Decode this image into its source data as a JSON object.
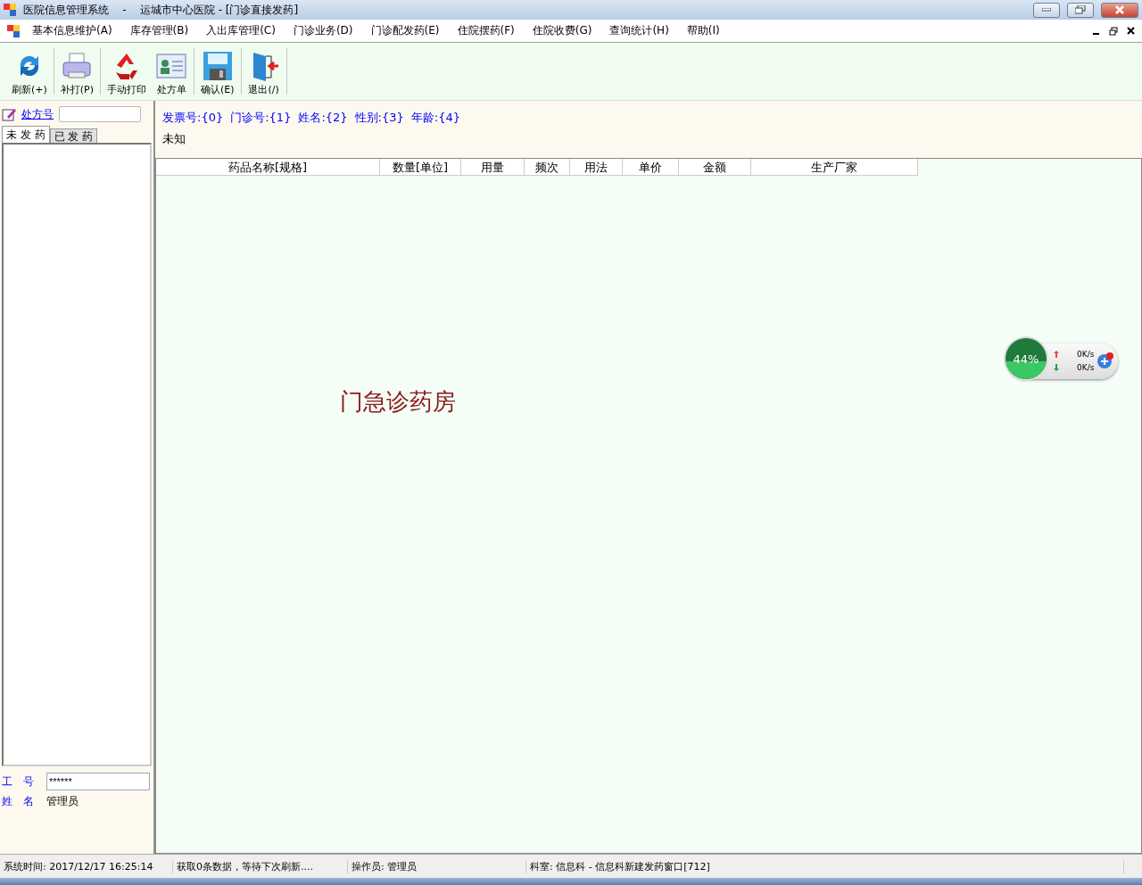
{
  "window": {
    "title": "医院信息管理系统    -    运城市中心医院 - [门诊直接发药]"
  },
  "menu": [
    "基本信息维护(A)",
    "库存管理(B)",
    "入出库管理(C)",
    "门诊业务(D)",
    "门诊配发药(E)",
    "住院摆药(F)",
    "住院收费(G)",
    "查询统计(H)",
    "帮助(I)"
  ],
  "toolbar": [
    {
      "kind": "refresh",
      "label": "刷新(+)",
      "sep": true
    },
    {
      "kind": "print",
      "label": "补打(P)",
      "sep": true
    },
    {
      "kind": "recycle",
      "label": "手动打印",
      "sep": false
    },
    {
      "kind": "card",
      "label": "处方单",
      "sep": true
    },
    {
      "kind": "save",
      "label": "确认(E)",
      "sep": true
    },
    {
      "kind": "exit",
      "label": "退出(/)",
      "sep": true
    }
  ],
  "left": {
    "prescription_link": "处方号",
    "tabs": [
      {
        "label": "未 发 药",
        "selected": true
      },
      {
        "label": "已 发 药",
        "selected": false
      }
    ],
    "staff_id_label": "工　号",
    "staff_id_value": "******",
    "name_label": "姓　名",
    "name_value": "管理员"
  },
  "info": {
    "fields": [
      "发票号:{0}",
      "门诊号:{1}",
      "姓名:{2}",
      "性别:{3}",
      "年龄:{4}"
    ],
    "line2": "未知"
  },
  "table": {
    "columns": [
      "药品名称[规格]",
      "数量[单位]",
      "用量",
      "频次",
      "用法",
      "单价",
      "金额",
      "生产厂家"
    ]
  },
  "watermark_text": "门急诊药房",
  "widget": {
    "percent": "44%",
    "up": "0K/s",
    "down": "0K/s"
  },
  "status_bar": [
    "系统时间: 2017/12/17 16:25:14",
    "获取0条数据，等待下次刷新....",
    "操作员: 管理员",
    "科室: 信息科 - 信息科新建发药窗口[712]"
  ]
}
